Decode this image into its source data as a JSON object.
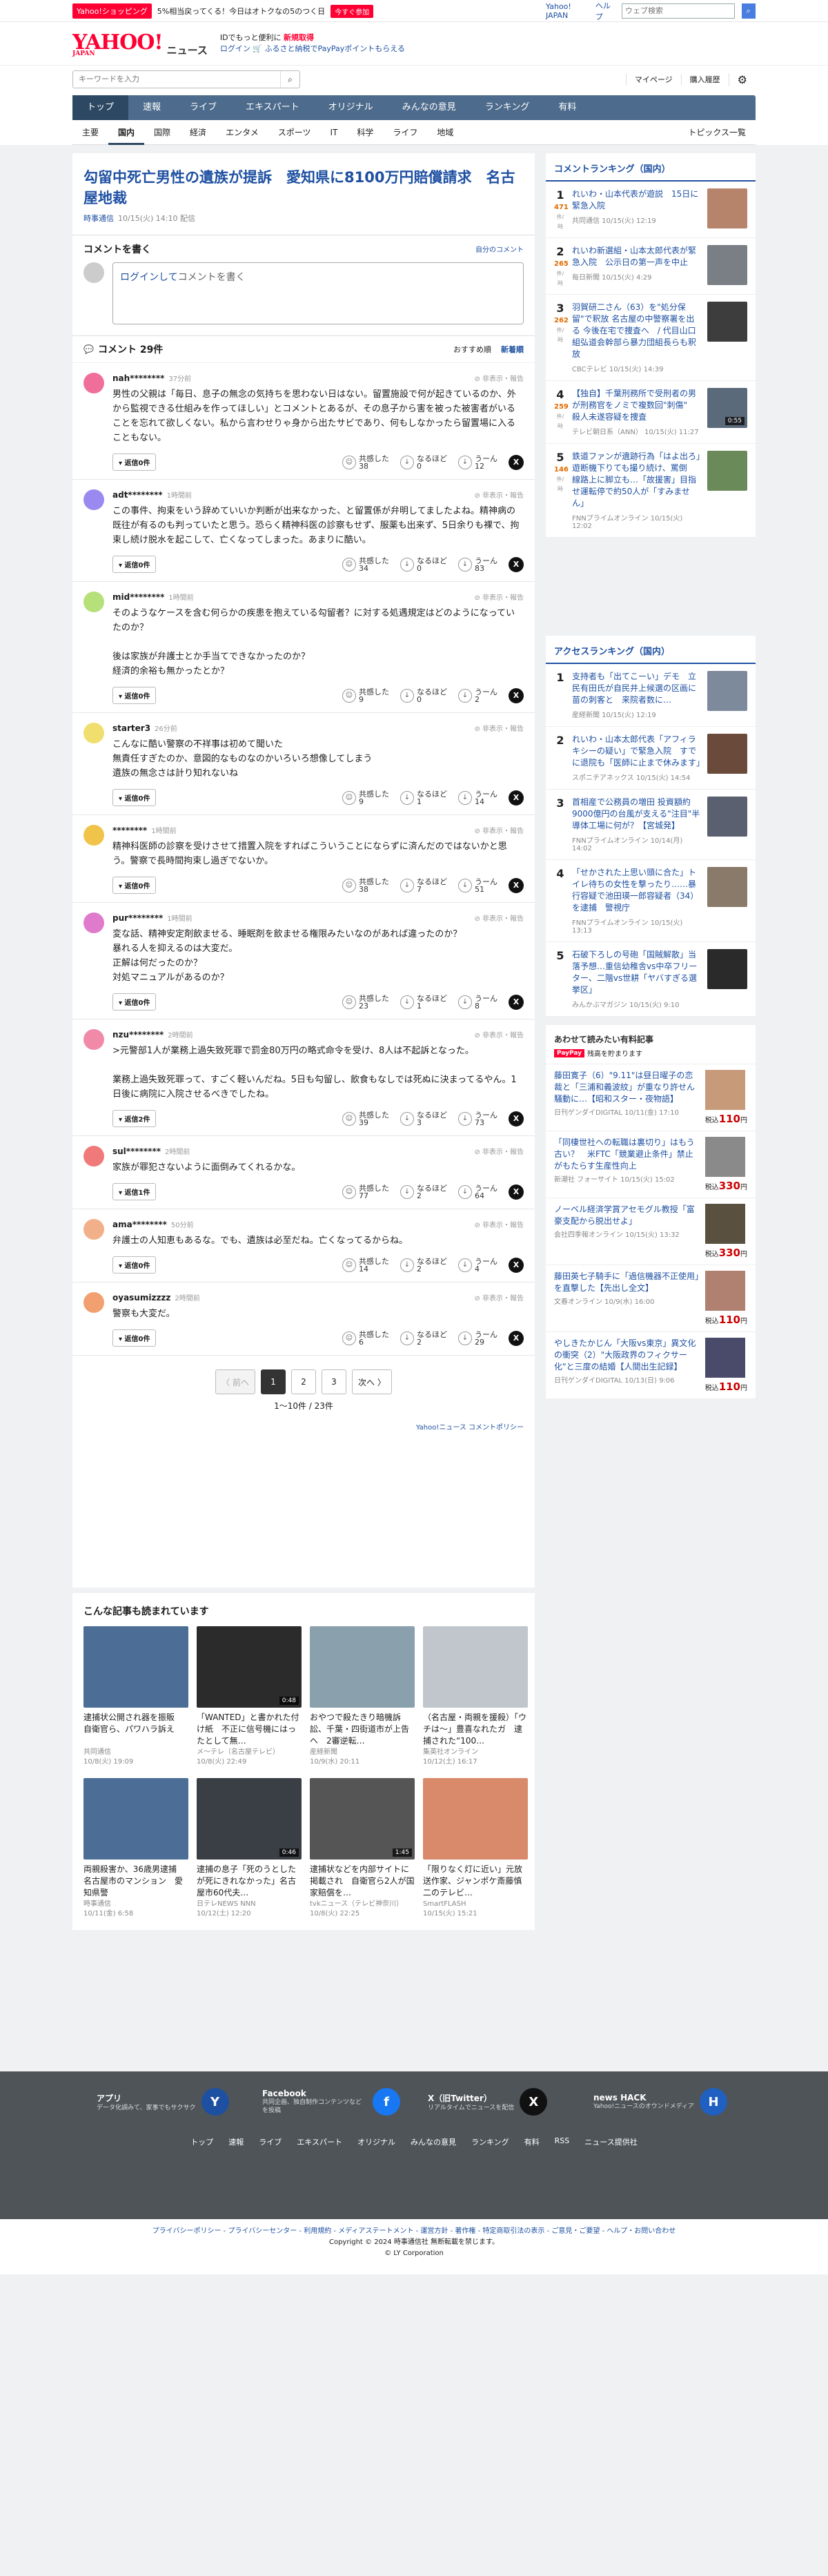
{
  "promo": {
    "tag": "Yahoo!ショッピング",
    "text": "5%相当戻ってくる！今日はオトクなの5のつく日",
    "button": "今すぐ参加",
    "links": [
      "Yahoo! JAPAN",
      "ヘルプ"
    ],
    "search_placeholder": "ウェブ検索"
  },
  "header": {
    "logo": "YAHOO!",
    "logo_sub": "JAPAN",
    "service": "ニュース",
    "msg1": "IDでもっと便利に",
    "msg1b": "新規取得",
    "msg2a": "ログイン",
    "msg2b": "ふるさと納税でPayPayポイントもらえる"
  },
  "search": {
    "placeholder": "キーワードを入力",
    "links": [
      "マイページ",
      "購入履歴"
    ]
  },
  "nav": {
    "main": [
      "トップ",
      "速報",
      "ライブ",
      "エキスパート",
      "オリジナル",
      "みんなの意見",
      "ランキング",
      "有料"
    ],
    "sub": [
      "主要",
      "国内",
      "国際",
      "経済",
      "エンタメ",
      "スポーツ",
      "IT",
      "科学",
      "ライフ",
      "地域"
    ],
    "topics": "トピックス一覧"
  },
  "article": {
    "title": "勾留中死亡男性の遺族が提訴　愛知県に8100万円賠償請求　名古屋地裁",
    "source": "時事通信",
    "date": "10/15(火) 14:10 配信"
  },
  "comment_form": {
    "title": "コメントを書く",
    "my_comments": "自分のコメント",
    "login": "ログインして",
    "placeholder_rest": "コメントを書く"
  },
  "comments_head": {
    "title": "コメント 29件",
    "sort_recommend": "おすすめ順",
    "sort_new": "新着順"
  },
  "vote_labels": {
    "agree": "共感した",
    "understand": "なるほど",
    "hmm": "うーん"
  },
  "report": "非表示・報告",
  "comments": [
    {
      "user": "nah********",
      "time": "37分前",
      "text": "男性の父親は「毎日、息子の無念の気持ちを思わない日はない。留置施設で何が起きているのか、外から監視できる仕組みを作ってほしい」とコメントとあるが、その息子から害を被った被害者がいることを忘れて欲しくない。私から言わせりゃ身から出たサビであり、何もしなかったら留置場に入ることもない。",
      "reply": "返信0件",
      "agree": "38",
      "understand": "0",
      "hmm": "12",
      "color": "#f06f9a"
    },
    {
      "user": "adt********",
      "time": "1時間前",
      "text": "この事件、拘束をいう辞めていいか判断が出来なかった、と留置係が弁明してましたよね。精神病の既往が有るのも判っていたと思う。恐らく精神科医の診察もせず、服薬も出来ず、5日余りも裸で、拘束し続け脱水を起こして、亡くなってしまった。あまりに酷い。",
      "reply": "返信0件",
      "agree": "34",
      "understand": "0",
      "hmm": "83",
      "color": "#9a8af0"
    },
    {
      "user": "mid********",
      "time": "1時間前",
      "text": "そのようなケースを含む何らかの疾患を抱えている勾留者？に対する処遇規定はどのようになっていたのか？\n\n後は家族が弁護士とか手当てできなかったのか？\n経済的余裕も無かったとか？",
      "reply": "返信0件",
      "agree": "9",
      "understand": "0",
      "hmm": "2",
      "color": "#b5e07a"
    },
    {
      "user": "starter3",
      "time": "26分前",
      "text": "こんなに酷い警察の不祥事は初めて聞いた\n無責任すぎたのか、意図的なものなのかいろいろ想像してしまう\n遺族の無念さは計り知れないね",
      "reply": "返信0件",
      "agree": "9",
      "understand": "1",
      "hmm": "14",
      "color": "#f0df6e"
    },
    {
      "user": "********",
      "time": "1時間前",
      "text": "精神科医師の診察を受けさせて措置入院をすればこういうことにならずに済んだのではないかと思う。警察で長時間拘束し過ぎでないか。",
      "reply": "返信0件",
      "agree": "38",
      "understand": "7",
      "understand_fix": "7",
      "hmm": "51",
      "color": "#f0c44a"
    },
    {
      "user": "pur********",
      "time": "1時間前",
      "text": "変な話、精神安定剤飲ませる、睡眠剤を飲ませる権限みたいなのがあれば違ったのか？\n暴れる人を抑えるのは大変だ。\n正解は何だったのか？\n対処マニュアルがあるのか？",
      "reply": "返信0件",
      "agree": "23",
      "understand": "1",
      "hmm": "8",
      "color": "#e07acc"
    },
    {
      "user": "nzu********",
      "time": "2時間前",
      "text": ">元警部1人が業務上過失致死罪で罰金80万円の略式命令を受け、8人は不起訴となった。\n\n業務上過失致死罪って、すごく軽いんだね。5日も勾留し、飲食もなしでは死ぬに決まってるやん。1日後に病院に入院させるべきでしたね。",
      "reply": "返信2件",
      "agree": "39",
      "understand": "3",
      "hmm": "73",
      "color": "#f08aa8"
    },
    {
      "user": "sul********",
      "time": "2時間前",
      "text": "家族が罪犯さないように面倒みてくれるかな。",
      "reply": "返信1件",
      "agree": "77",
      "understand": "2",
      "hmm": "64",
      "color": "#f07a7a"
    },
    {
      "user": "ama********",
      "time": "50分前",
      "text": "弁護士の人知恵もあるな。でも、遺族は必至だね。亡くなってるからね。",
      "reply": "返信0件",
      "agree": "14",
      "understand": "2",
      "hmm": "4",
      "color": "#f2b08a"
    },
    {
      "user": "oyasumizzzz",
      "time": "2時間前",
      "text": "警察も大変だ。",
      "reply": "返信0件",
      "agree": "6",
      "understand": "2",
      "hmm": "29",
      "color": "#f2a070"
    }
  ],
  "pager": {
    "prev": "〈 前へ",
    "pages": [
      "1",
      "2",
      "3"
    ],
    "next": "次へ 〉",
    "info": "1〜10件 / 23件"
  },
  "policy": "Yahoo!ニュース コメントポリシー",
  "reco": {
    "title": "こんな記事も読まれています",
    "items": [
      {
        "title": "逮捕状公開され器を振販　自衛官ら、パワハラ訴え",
        "src": "共同通信",
        "date": "10/8(火) 19:09",
        "color": "#4c6e96",
        "dur": ""
      },
      {
        "title": "「WANTED」と書かれた付け紙　不正に信号機にはったとして無…",
        "src": "メ〜テレ（名古屋テレビ）",
        "date": "10/8(火) 22:49",
        "color": "#2b2b2b",
        "dur": "0:48"
      },
      {
        "title": "おやつで殺たきり暗機訴訟、千葉・四街道市が上告へ　2審逆転…",
        "src": "産経新聞",
        "date": "10/9(水) 20:11",
        "color": "#8ba0ad",
        "dur": ""
      },
      {
        "title": "（名古屋・両親を援殺）「ウチは〜」豊喜なれたガ　逮捕された“100…",
        "src": "集英社オンライン",
        "date": "10/12(土) 16:17",
        "color": "#c0c6cc",
        "dur": ""
      },
      {
        "title": "両親殺害か、36歳男逮捕　名古屋市のマンション　愛知県警",
        "src": "時事通信",
        "date": "10/11(金) 6:58",
        "color": "#4c6e96",
        "dur": ""
      },
      {
        "title": "逮捕の息子「死のうとしたが死にきれなかった」名古屋市60代夫…",
        "src": "日テレNEWS NNN",
        "date": "10/12(土) 12:20",
        "color": "#3a3f46",
        "dur": "0:46"
      },
      {
        "title": "逮捕状などを内部サイトに掲載され　自衛官ら2人が国家賠償を…",
        "src": "tvkニュース（テレビ神奈川）",
        "date": "10/8(火) 22:25",
        "color": "#555",
        "dur": "1:45"
      },
      {
        "title": "「限りなく灯に近い」元放送作家、ジャンポケ斎藤慎二のテレビ…",
        "src": "SmartFLASH",
        "date": "10/15(火) 15:21",
        "color": "#d88a6a",
        "dur": ""
      }
    ]
  },
  "comment_ranking": {
    "title": "コメントランキング（国内）",
    "unit": "件/時",
    "items": [
      {
        "n": "1",
        "cnt": "471",
        "title": "れいわ・山本代表が遊説　15日に緊急入院",
        "src": "共同通信 10/15(火) 12:19",
        "color": "#b5846a"
      },
      {
        "n": "2",
        "cnt": "265",
        "title": "れいわ新選組・山本太郎代表が緊急入院　公示日の第一声を中止",
        "src": "毎日新聞 10/15(火) 4:29",
        "color": "#7a7f86"
      },
      {
        "n": "3",
        "cnt": "262",
        "title": "羽賀研二さん（63）を\"処分保留\"で釈放 名古屋の中警察署を出る 今後在宅で捜査へ　/ 代目山口組弘道会幹部ら暴力団組長らも釈放",
        "src": "CBCテレビ 10/15(火) 14:39",
        "color": "#3d3d3d"
      },
      {
        "n": "4",
        "cnt": "259",
        "title": "【独自】千葉刑務所で受刑者の男が刑務官をノミで複数回\"刺傷\"　殺人未遂容疑を捜査",
        "src": "テレビ朝日系（ANN） 10/15(火) 11:27",
        "color": "#5a6a7a",
        "dur": "0:55"
      },
      {
        "n": "5",
        "cnt": "146",
        "title": "鉄道ファンが遺跡行為「はよ出ろ」遊断機下りても撮り続け、罵倒　線路上に脚立も…「故援害」目指せ運転停で約50人が「すみません」",
        "src": "FNNプライムオンライン 10/15(火) 12:02",
        "color": "#6a8a5a"
      }
    ]
  },
  "access_ranking": {
    "title": "アクセスランキング（国内）",
    "items": [
      {
        "n": "1",
        "title": "支持者も「出てこーい」デモ　立民有田氏が自民井上候選の区画に苗の刺客と　来院者数に…",
        "src": "産経新聞 10/15(火) 12:19",
        "color": "#7d8a9b"
      },
      {
        "n": "2",
        "title": "れいわ・山本太郎代表「アフィラキシーの疑い」で緊急入院　すでに退院も「医師に止まで休みます」",
        "src": "スポニチアネックス 10/15(火) 14:54",
        "color": "#6a4a3a"
      },
      {
        "n": "3",
        "title": "首相産で公務員の増田 投資額約9000億円の台風が支える\"注目\"半導体工場に何が？【宮城発】",
        "src": "FNNプライムオンライン 10/14(月) 14:02",
        "color": "#5a6070"
      },
      {
        "n": "4",
        "title": "「せかされた上思い頭に合た」トイレ待ちの女性を撃ったり……暴行容疑で池田瑛一郎容疑者（34）を逮捕　警視庁",
        "src": "FNNプライムオンライン 10/15(火) 13:13",
        "color": "#8a7a6a"
      },
      {
        "n": "5",
        "title": "石破下ろしの号砲「国賊解散」当落予想…重信幼稚舎vs中卒フリーター、二階vs世耕「ヤバすぎる選挙区」",
        "src": "みんかぶマガジン 10/15(火) 9:10",
        "color": "#2a2a2a"
      }
    ]
  },
  "ads": {
    "title": "あわせて読みたい有料記事",
    "brand": "PayPay",
    "brand_rest": "残高を貯まります",
    "items": [
      {
        "title": "藤田寛子（6）\"9.11\"は昼日曜子の恋裁と「三浦和義波紋」が重なり許せん騒動に…【昭和スター・夜物語】",
        "src": "日刊ゲンダイDIGITAL 10/11(金) 17:10",
        "price": "110",
        "color": "#c79a7a"
      },
      {
        "title": "「同棲世社への転職は裏切り」はもう古い？　米FTC「競業避止条件」禁止がもたらす生産性向上",
        "src": "新潮社 フォーサイト 10/15(火) 15:02",
        "price": "330",
        "color": "#8a8a8a"
      },
      {
        "title": "ノーベル経済学賞アセモグル教授「富豪支配から脱出せよ」",
        "src": "会社四季報オンライン 10/15(火) 13:32",
        "price": "330",
        "color": "#5a5040"
      },
      {
        "title": "藤田英七子騎手に「過信機器不正使用」を直撃した【先出し全文】",
        "src": "文春オンライン 10/9(水) 16:00",
        "price": "110",
        "color": "#b08070"
      },
      {
        "title": "やしきたかじん「大阪vs東京」異文化の衝突（2）\"大阪政界のフィクサー化\"と三度の結婚【人間出生記録】",
        "src": "日刊ゲンダイDIGITAL 10/13(日) 9:06",
        "price": "110",
        "color": "#4a4a6a"
      }
    ]
  },
  "footer": {
    "apps": [
      {
        "name": "アプリ",
        "desc": "データ化調みて、家事でもサクサク",
        "color": "#1e50a2",
        "icon": "Y"
      },
      {
        "name": "Facebook",
        "desc": "共同企画、独自制作コンテンツなどを投稿",
        "color": "#1877f2",
        "icon": "f"
      },
      {
        "name": "X（旧Twitter）",
        "desc": "リアルタイムでニュースを配信",
        "color": "#111",
        "icon": "X"
      },
      {
        "name": "news HACK",
        "desc": "Yahoo!ニュースのオウンドメディア",
        "color": "#2060c0",
        "icon": "H"
      }
    ],
    "links": [
      "トップ",
      "速報",
      "ライブ",
      "エキスパート",
      "オリジナル",
      "みんなの意見",
      "ランキング",
      "有料",
      "RSS",
      "ニュース提供社"
    ],
    "legal": "プライバシーポリシー - プライバシーセンター - 利用規約 - メディアステートメント - 運営方針 - 著作権 - 特定商取引法の表示 - ご意見・ご要望 - ヘルプ・お問い合わせ",
    "copy1": "Copyright © 2024 時事通信社 無断転載を禁じます。",
    "copy2": "© LY Corporation"
  }
}
